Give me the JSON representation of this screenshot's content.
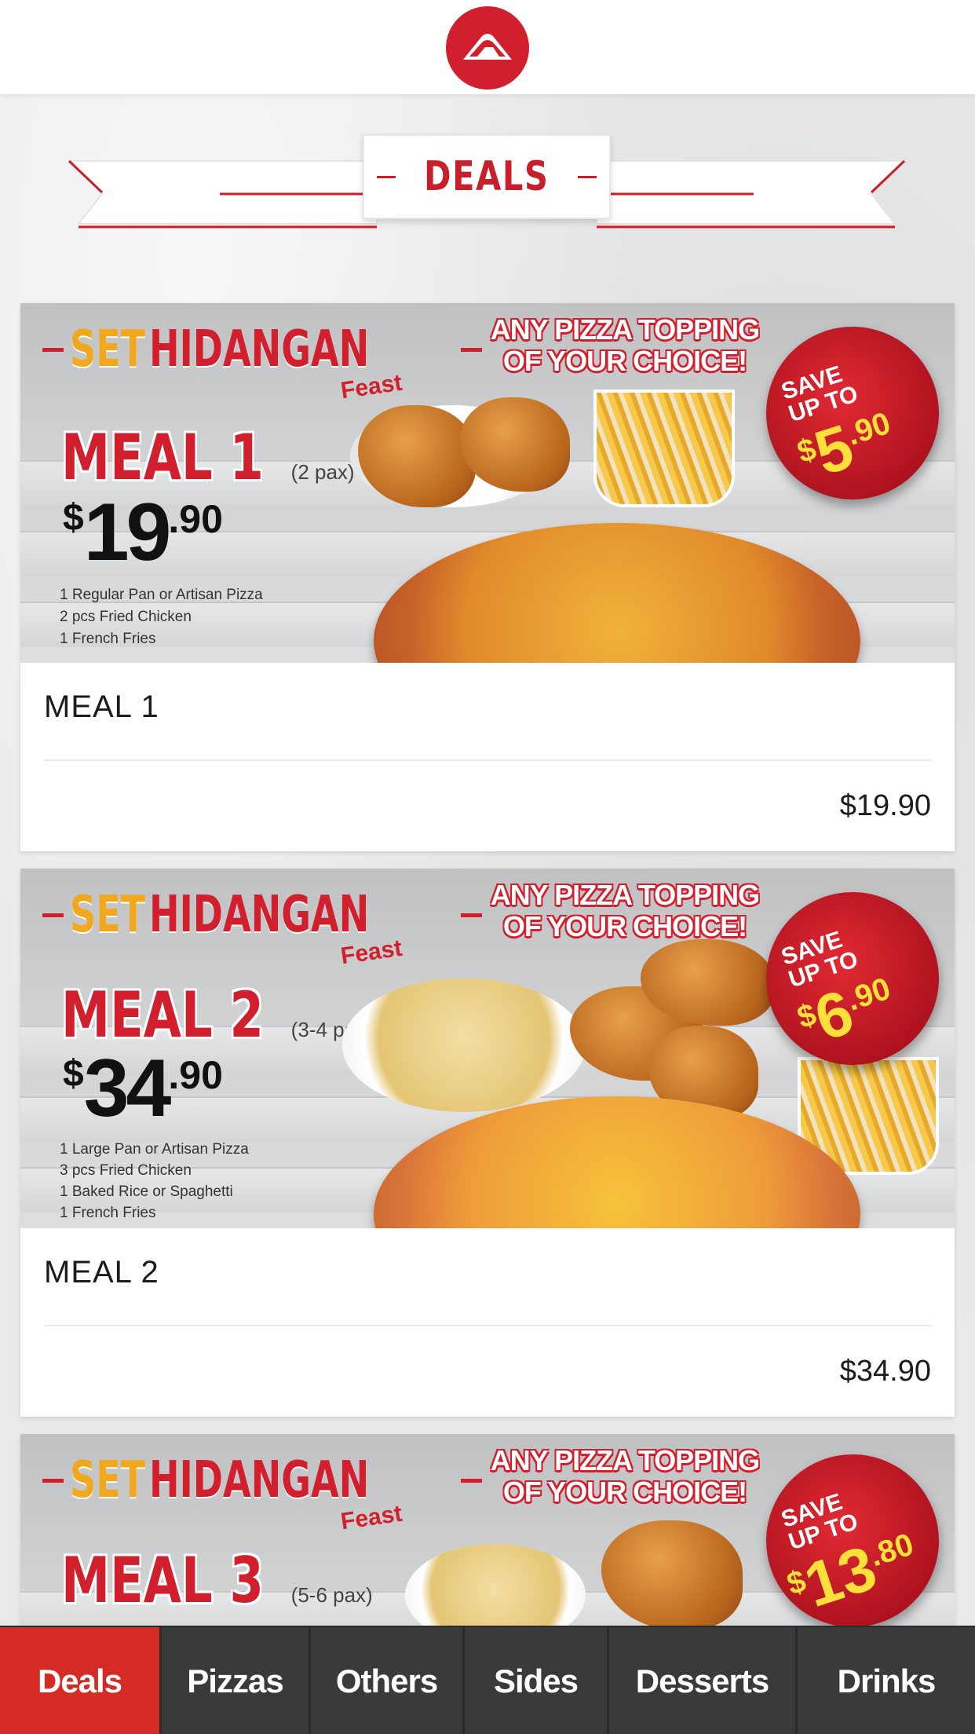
{
  "header": {
    "logo": "pizza-hut-logo"
  },
  "section": {
    "title": "DEALS"
  },
  "promo": {
    "set_word": "SET",
    "hidangan_word": "HIDANGAN",
    "feast_word": "Feast",
    "topping_line1": "ANY PIZZA TOPPING",
    "topping_line2": "OF YOUR CHOICE!",
    "save_line1": "SAVE",
    "save_line2": "UP TO"
  },
  "deals": [
    {
      "banner_meal": "MEAL 1",
      "pax": "(2 pax)",
      "price_currency": "$",
      "price_whole": "19",
      "price_cents": ".90",
      "desc": [
        "1 Regular Pan or Artisan Pizza",
        "2 pcs Fried Chicken",
        "1 French Fries"
      ],
      "save_currency": "$",
      "save_whole": "5",
      "save_cents": ".90",
      "title": "MEAL 1",
      "price": "$19.90"
    },
    {
      "banner_meal": "MEAL 2",
      "pax": "(3-4 pax)",
      "price_currency": "$",
      "price_whole": "34",
      "price_cents": ".90",
      "desc": [
        "1 Large Pan or Artisan Pizza",
        "3 pcs Fried Chicken",
        "1 Baked Rice or Spaghetti",
        "1 French Fries"
      ],
      "save_currency": "$",
      "save_whole": "6",
      "save_cents": ".90",
      "title": "MEAL 2",
      "price": "$34.90"
    },
    {
      "banner_meal": "MEAL 3",
      "pax": "(5-6 pax)",
      "save_currency": "$",
      "save_whole": "13",
      "save_cents": ".80"
    }
  ],
  "nav": {
    "tabs": [
      "Deals",
      "Pizzas",
      "Others",
      "Sides",
      "Desserts",
      "Drinks"
    ],
    "active": "Deals"
  },
  "colors": {
    "brand_red": "#d11f2e",
    "nav_bg": "#3a3a3a",
    "nav_active": "#d52b25",
    "accent_yellow": "#f2a81d"
  }
}
